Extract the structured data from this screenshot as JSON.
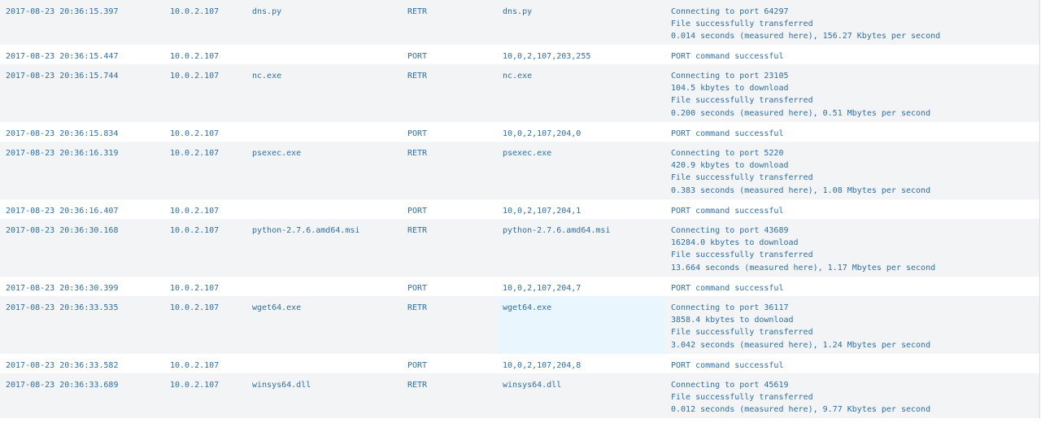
{
  "rows": [
    {
      "time": "2017-08-23 20:36:15.397",
      "src": "10.0.2.107",
      "arg": "dns.py",
      "cmd": "RETR",
      "info": "dns.py",
      "reply": [
        "Connecting to port 64297",
        "File successfully transferred",
        "0.014 seconds (measured here), 156.27 Kbytes per second"
      ]
    },
    {
      "time": "2017-08-23 20:36:15.447",
      "src": "10.0.2.107",
      "arg": "",
      "cmd": "PORT",
      "info": "10,0,2,107,203,255",
      "reply": [
        "PORT command successful"
      ]
    },
    {
      "time": "2017-08-23 20:36:15.744",
      "src": "10.0.2.107",
      "arg": "nc.exe",
      "cmd": "RETR",
      "info": "nc.exe",
      "reply": [
        "Connecting to port 23105",
        "104.5 kbytes to download",
        "File successfully transferred",
        "0.200 seconds (measured here), 0.51 Mbytes per second"
      ]
    },
    {
      "time": "2017-08-23 20:36:15.834",
      "src": "10.0.2.107",
      "arg": "",
      "cmd": "PORT",
      "info": "10,0,2,107,204,0",
      "reply": [
        "PORT command successful"
      ]
    },
    {
      "time": "2017-08-23 20:36:16.319",
      "src": "10.0.2.107",
      "arg": "psexec.exe",
      "cmd": "RETR",
      "info": "psexec.exe",
      "reply": [
        "Connecting to port 5220",
        "420.9 kbytes to download",
        "File successfully transferred",
        "0.383 seconds (measured here), 1.08 Mbytes per second"
      ]
    },
    {
      "time": "2017-08-23 20:36:16.407",
      "src": "10.0.2.107",
      "arg": "",
      "cmd": "PORT",
      "info": "10,0,2,107,204,1",
      "reply": [
        "PORT command successful"
      ]
    },
    {
      "time": "2017-08-23 20:36:30.168",
      "src": "10.0.2.107",
      "arg": "python-2.7.6.amd64.msi",
      "cmd": "RETR",
      "info": "python-2.7.6.amd64.msi",
      "reply": [
        "Connecting to port 43689",
        "16284.0 kbytes to download",
        "File successfully transferred",
        "13.664 seconds (measured here), 1.17 Mbytes per second"
      ]
    },
    {
      "time": "2017-08-23 20:36:30.399",
      "src": "10.0.2.107",
      "arg": "",
      "cmd": "PORT",
      "info": "10,0,2,107,204,7",
      "reply": [
        "PORT command successful"
      ]
    },
    {
      "time": "2017-08-23 20:36:33.535",
      "src": "10.0.2.107",
      "arg": "wget64.exe",
      "cmd": "RETR",
      "info": "wget64.exe",
      "highlight_info": true,
      "reply": [
        "Connecting to port 36117",
        "3858.4 kbytes to download",
        "File successfully transferred",
        "3.042 seconds (measured here), 1.24 Mbytes per second"
      ]
    },
    {
      "time": "2017-08-23 20:36:33.582",
      "src": "10.0.2.107",
      "arg": "",
      "cmd": "PORT",
      "info": "10,0,2,107,204,8",
      "reply": [
        "PORT command successful"
      ]
    },
    {
      "time": "2017-08-23 20:36:33.689",
      "src": "10.0.2.107",
      "arg": "winsys64.dll",
      "cmd": "RETR",
      "info": "winsys64.dll",
      "reply": [
        "Connecting to port 45619",
        "File successfully transferred",
        "0.012 seconds (measured here), 9.77 Kbytes per second"
      ]
    }
  ]
}
